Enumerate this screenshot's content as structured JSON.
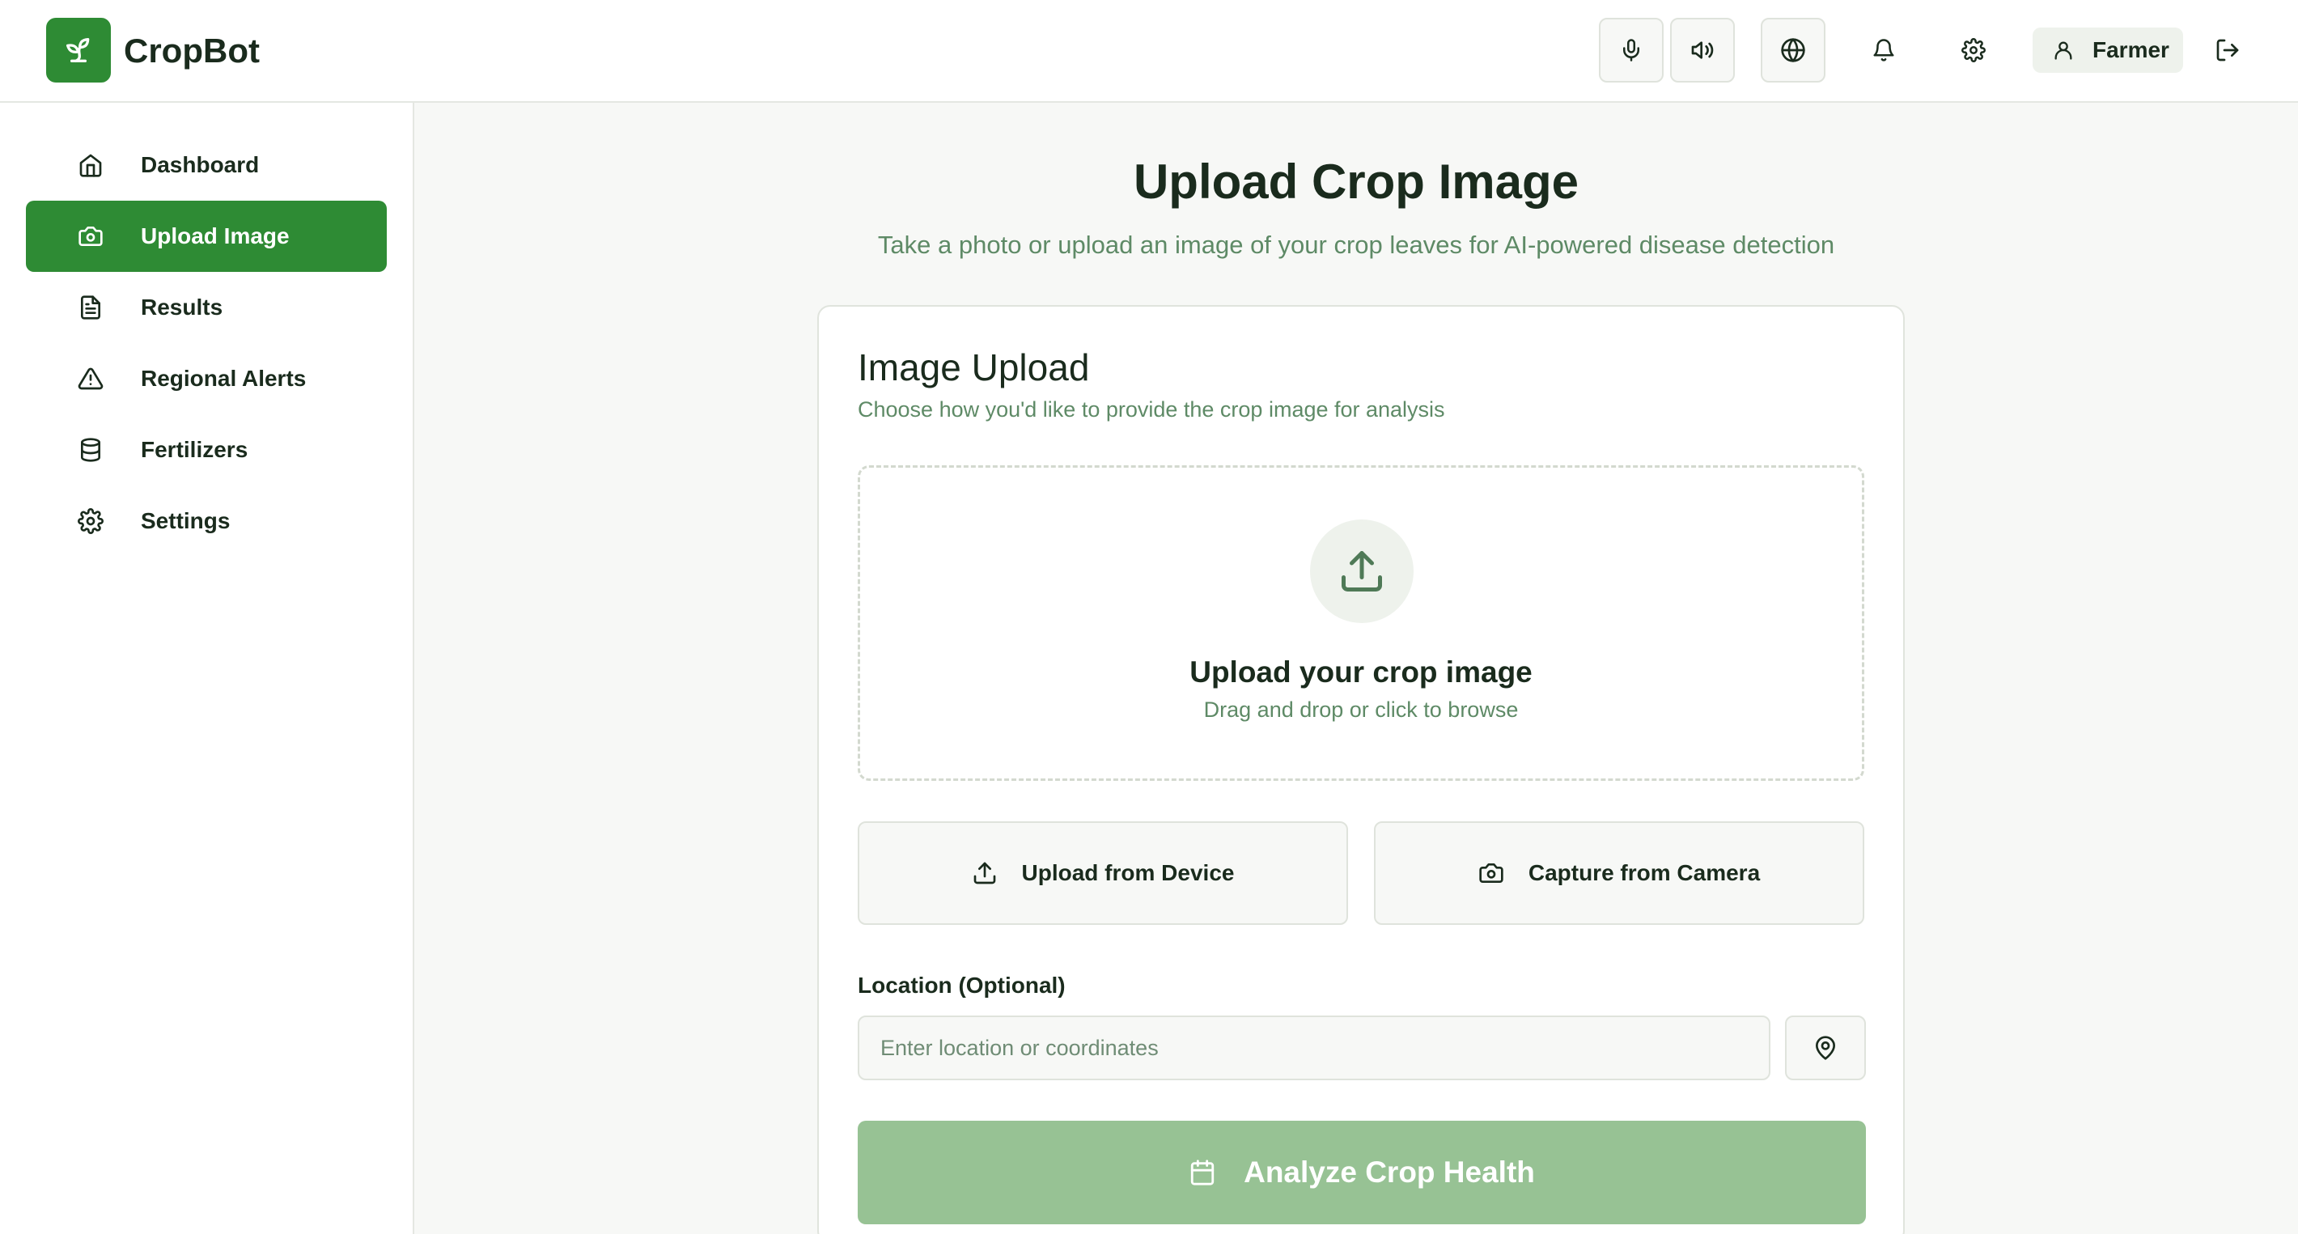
{
  "header": {
    "brand": "CropBot",
    "user_name": "Farmer"
  },
  "sidebar": {
    "items": [
      {
        "label": "Dashboard",
        "icon": "home-icon",
        "active": false
      },
      {
        "label": "Upload Image",
        "icon": "camera-icon",
        "active": true
      },
      {
        "label": "Results",
        "icon": "document-icon",
        "active": false
      },
      {
        "label": "Regional Alerts",
        "icon": "warning-icon",
        "active": false
      },
      {
        "label": "Fertilizers",
        "icon": "database-icon",
        "active": false
      },
      {
        "label": "Settings",
        "icon": "gear-icon",
        "active": false
      }
    ]
  },
  "main": {
    "title": "Upload Crop Image",
    "subtitle": "Take a photo or upload an image of your crop leaves for AI-powered disease detection",
    "card": {
      "title": "Image Upload",
      "subtitle": "Choose how you'd like to provide the crop image for analysis",
      "dropzone_title": "Upload your crop image",
      "dropzone_subtitle": "Drag and drop or click to browse",
      "upload_device_label": "Upload from Device",
      "capture_camera_label": "Capture from Camera",
      "location_label": "Location (Optional)",
      "location_placeholder": "Enter location or coordinates",
      "analyze_label": "Analyze Crop Health"
    }
  },
  "colors": {
    "accent": "#2e8b34",
    "accent_disabled": "#97c294",
    "muted_text": "#5e8a66",
    "border": "#dfe3dc"
  }
}
